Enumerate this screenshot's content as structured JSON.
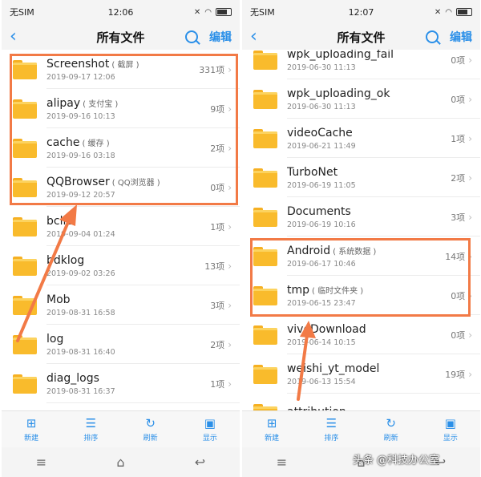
{
  "left": {
    "status": {
      "carrier": "无SIM",
      "time": "12:06"
    },
    "header": {
      "title": "所有文件",
      "edit": "编辑"
    },
    "folders": [
      {
        "name": "Screenshot",
        "alias": "( 截屏 )",
        "date": "2019-09-17 12:06",
        "count": "331项"
      },
      {
        "name": "alipay",
        "alias": "( 支付宝 )",
        "date": "2019-09-16 10:13",
        "count": "9项"
      },
      {
        "name": "cache",
        "alias": "( 缓存 )",
        "date": "2019-09-16 03:18",
        "count": "2项"
      },
      {
        "name": "QQBrowser",
        "alias": "( QQ浏览器 )",
        "date": "2019-09-12 20:57",
        "count": "0项"
      },
      {
        "name": "bclib",
        "alias": "",
        "date": "2019-09-04 01:24",
        "count": "1项"
      },
      {
        "name": "bdklog",
        "alias": "",
        "date": "2019-09-02 03:26",
        "count": "13项"
      },
      {
        "name": "Mob",
        "alias": "",
        "date": "2019-08-31 16:58",
        "count": "3项"
      },
      {
        "name": "log",
        "alias": "",
        "date": "2019-08-31 16:40",
        "count": "2项"
      },
      {
        "name": "diag_logs",
        "alias": "",
        "date": "2019-08-31 16:37",
        "count": "1项"
      }
    ]
  },
  "right": {
    "status": {
      "carrier": "无SIM",
      "time": "12:07"
    },
    "header": {
      "title": "所有文件",
      "edit": "编辑"
    },
    "folders": [
      {
        "name": "wpk_uploading_fail",
        "alias": "",
        "date": "2019-06-30 11:13",
        "count": "0项"
      },
      {
        "name": "wpk_uploading_ok",
        "alias": "",
        "date": "2019-06-30 11:13",
        "count": "0项"
      },
      {
        "name": "videoCache",
        "alias": "",
        "date": "2019-06-21 11:49",
        "count": "1项"
      },
      {
        "name": "TurboNet",
        "alias": "",
        "date": "2019-06-19 11:05",
        "count": "2项"
      },
      {
        "name": "Documents",
        "alias": "",
        "date": "2019-06-19 10:16",
        "count": "3项"
      },
      {
        "name": "Android",
        "alias": "( 系统数据 )",
        "date": "2019-06-17 10:46",
        "count": "14项"
      },
      {
        "name": "tmp",
        "alias": "( 临时文件夹 )",
        "date": "2019-06-15 23:47",
        "count": "0项"
      },
      {
        "name": "vivoDownload",
        "alias": "",
        "date": "2019-06-14 10:15",
        "count": "0项"
      },
      {
        "name": "weishi_yt_model",
        "alias": "",
        "date": "2019-06-13 15:54",
        "count": "19项"
      },
      {
        "name": "attribution",
        "alias": "",
        "date": "",
        "count": ""
      }
    ]
  },
  "toolbar": [
    {
      "icon": "new-folder-icon",
      "label": "新建"
    },
    {
      "icon": "sort-icon",
      "label": "排序"
    },
    {
      "icon": "refresh-icon",
      "label": "刷新"
    },
    {
      "icon": "display-icon",
      "label": "显示"
    }
  ],
  "watermark": "头条 @科技办公室",
  "colors": {
    "accent": "#2a8fe8",
    "folder": "#f9bb2c",
    "highlight": "#f27a46"
  }
}
